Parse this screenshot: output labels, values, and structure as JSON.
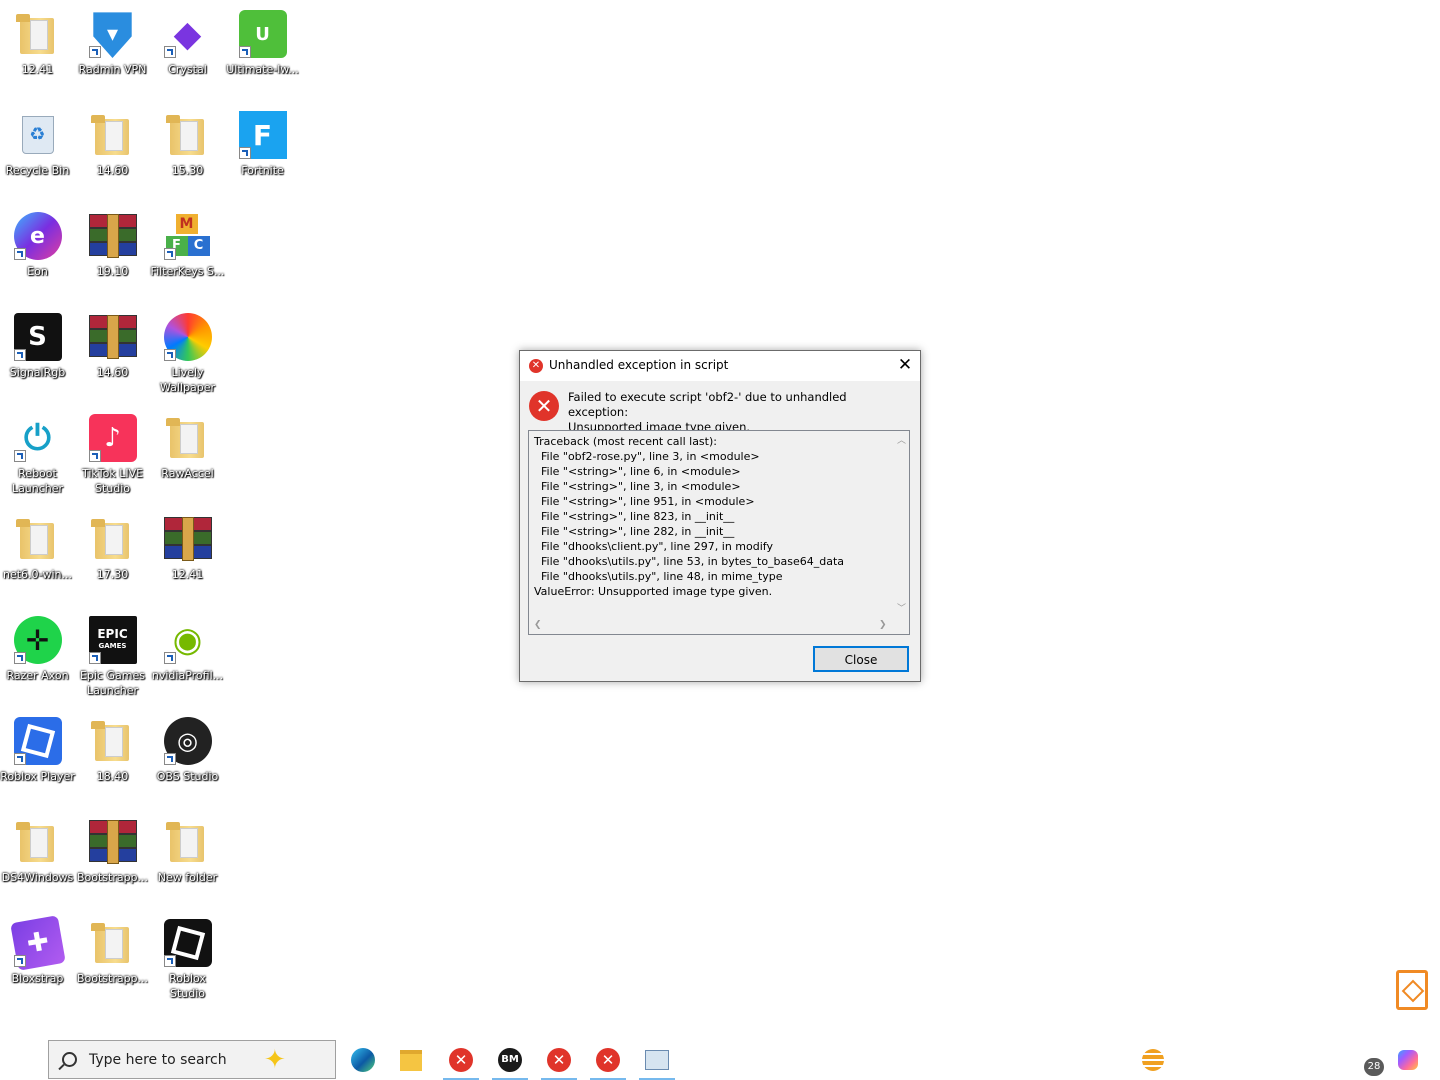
{
  "desktop": {
    "icons": [
      {
        "label": "12.41",
        "icon": "folder-icon"
      },
      {
        "label": "Radmin VPN",
        "icon": "radmin-vpn-icon"
      },
      {
        "label": "Crystal",
        "icon": "crystal-icon"
      },
      {
        "label": "Ultimate-lw...",
        "icon": "ultimate-icon"
      },
      {
        "label": "Recycle Bin",
        "icon": "recycle-bin-icon"
      },
      {
        "label": "14.60",
        "icon": "folder-icon"
      },
      {
        "label": "15.30",
        "icon": "folder-icon"
      },
      {
        "label": "Fortnite",
        "icon": "fortnite-icon"
      },
      {
        "label": "Eon",
        "icon": "eon-icon"
      },
      {
        "label": "19.10",
        "icon": "winrar-icon"
      },
      {
        "label": "FilterKeys S...",
        "icon": "filterkeys-icon"
      },
      {
        "label": "SignalRgb",
        "icon": "signalrgb-icon"
      },
      {
        "label": "14.60",
        "icon": "winrar-icon"
      },
      {
        "label": "Lively Wallpaper",
        "icon": "lively-wallpaper-icon"
      },
      {
        "label": "Reboot Launcher",
        "icon": "reboot-launcher-icon"
      },
      {
        "label": "TikTok LIVE Studio",
        "icon": "tiktok-icon"
      },
      {
        "label": "RawAccel",
        "icon": "folder-icon"
      },
      {
        "label": "net6.0-win...",
        "icon": "folder-icon"
      },
      {
        "label": "17.30",
        "icon": "folder-icon"
      },
      {
        "label": "12.41",
        "icon": "winrar-icon"
      },
      {
        "label": "Razer Axon",
        "icon": "razer-axon-icon"
      },
      {
        "label": "Epic Games Launcher",
        "icon": "epic-games-icon"
      },
      {
        "label": "nvidiaProfil...",
        "icon": "nvidia-icon"
      },
      {
        "label": "Roblox Player",
        "icon": "roblox-player-icon"
      },
      {
        "label": "18.40",
        "icon": "folder-icon"
      },
      {
        "label": "OBS Studio",
        "icon": "obs-icon"
      },
      {
        "label": "DS4Windows",
        "icon": "folder-icon"
      },
      {
        "label": "Bootstrapp...",
        "icon": "winrar-icon"
      },
      {
        "label": "New folder",
        "icon": "folder-icon"
      },
      {
        "label": "Bloxstrap",
        "icon": "bloxstrap-icon"
      },
      {
        "label": "Bootstrapp...",
        "icon": "folder-icon"
      },
      {
        "label": "Roblox Studio",
        "icon": "roblox-studio-icon"
      }
    ]
  },
  "dialog": {
    "title": "Unhandled exception in script",
    "message_line1": "Failed to execute script 'obf2-' due to unhandled exception:",
    "message_line2": "Unsupported image type given.",
    "traceback": [
      "Traceback (most recent call last):",
      "  File \"obf2-rose.py\", line 3, in <module>",
      "  File \"<string>\", line 6, in <module>",
      "  File \"<string>\", line 3, in <module>",
      "  File \"<string>\", line 951, in <module>",
      "  File \"<string>\", line 823, in __init__",
      "  File \"<string>\", line 282, in __init__",
      "  File \"dhooks\\client.py\", line 297, in modify",
      "  File \"dhooks\\utils.py\", line 53, in bytes_to_base64_data",
      "  File \"dhooks\\utils.py\", line 48, in mime_type",
      "ValueError: Unsupported image type given."
    ],
    "close_label": "Close"
  },
  "taskbar": {
    "search_placeholder": "Type here to search",
    "notification_count": "28"
  }
}
